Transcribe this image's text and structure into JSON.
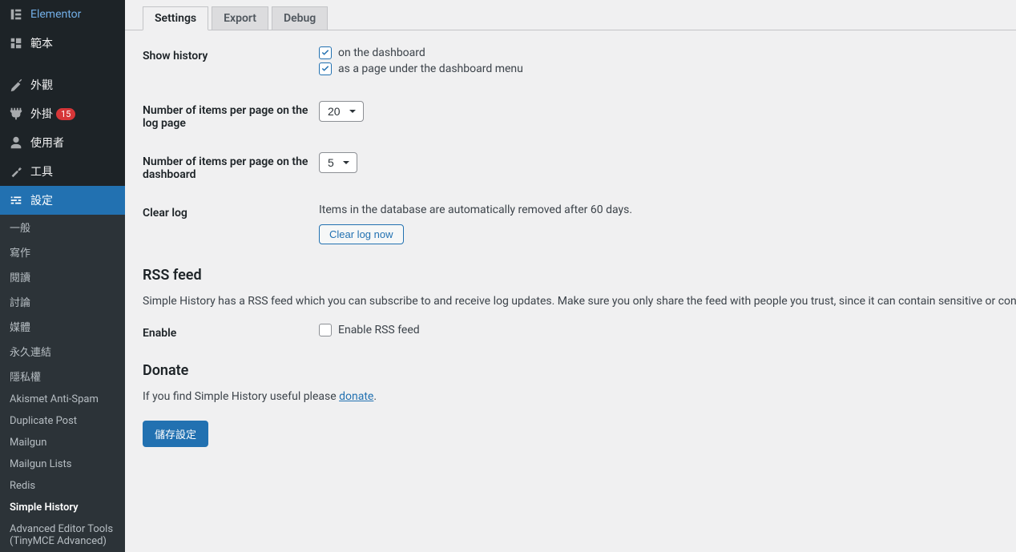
{
  "sidebar": {
    "top": [
      {
        "icon": "elementor",
        "label": "Elementor"
      },
      {
        "icon": "templates",
        "label": "範本"
      }
    ],
    "mid": [
      {
        "icon": "appearance",
        "label": "外觀"
      },
      {
        "icon": "plugins",
        "label": "外掛",
        "badge": "15"
      },
      {
        "icon": "users",
        "label": "使用者"
      },
      {
        "icon": "tools",
        "label": "工具"
      },
      {
        "icon": "settings",
        "label": "設定",
        "active": true
      }
    ],
    "sub": [
      {
        "label": "一般"
      },
      {
        "label": "寫作"
      },
      {
        "label": "閱讀"
      },
      {
        "label": "討論"
      },
      {
        "label": "媒體"
      },
      {
        "label": "永久連結"
      },
      {
        "label": "隱私權"
      },
      {
        "label": "Akismet Anti-Spam"
      },
      {
        "label": "Duplicate Post"
      },
      {
        "label": "Mailgun"
      },
      {
        "label": "Mailgun Lists"
      },
      {
        "label": "Redis"
      },
      {
        "label": "Simple History",
        "current": true
      },
      {
        "label": "Advanced Editor Tools (TinyMCE Advanced)"
      }
    ]
  },
  "tabs": [
    {
      "label": "Settings",
      "active": true
    },
    {
      "label": "Export"
    },
    {
      "label": "Debug"
    }
  ],
  "fields": {
    "show_history": {
      "label": "Show history",
      "cb1": "on the dashboard",
      "cb2": "as a page under the dashboard menu"
    },
    "items_log": {
      "label": "Number of items per page on the log page",
      "value": "20"
    },
    "items_dash": {
      "label": "Number of items per page on the dashboard",
      "value": "5"
    },
    "clear_log": {
      "label": "Clear log",
      "desc": "Items in the database are automatically removed after 60 days.",
      "btn": "Clear log now"
    }
  },
  "rss": {
    "heading": "RSS feed",
    "desc": "Simple History has a RSS feed which you can subscribe to and receive log updates. Make sure you only share the feed with people you trust, since it can contain sensitive or confide",
    "enable_label": "Enable",
    "enable_cb": "Enable RSS feed"
  },
  "donate": {
    "heading": "Donate",
    "pre": "If you find Simple History useful please ",
    "link": "donate",
    "post": "."
  },
  "save_btn": "儲存設定"
}
